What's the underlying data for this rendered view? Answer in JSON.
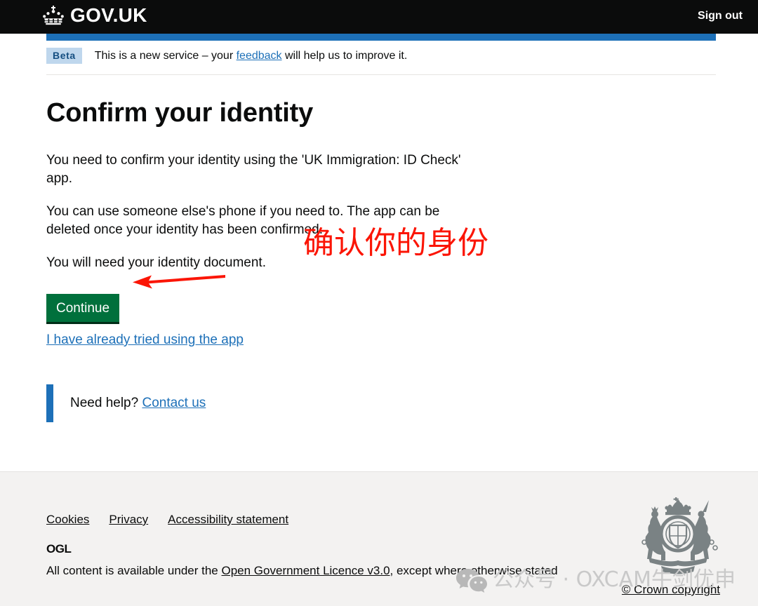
{
  "header": {
    "logo_text": "GOV.UK",
    "logo_icon": "crown-icon",
    "sign_out_label": "Sign out"
  },
  "phase_banner": {
    "tag": "Beta",
    "text_before": "This is a new service – your ",
    "link_label": "feedback",
    "text_after": " will help us to improve it."
  },
  "main": {
    "heading": "Confirm your identity",
    "paragraph_1": "You need to confirm your identity using the 'UK Immigration: ID Check' app.",
    "paragraph_2": "You can use someone else's phone if you need to. The app can be deleted once your identity has been confirmed.",
    "paragraph_3": "You will need your identity document.",
    "continue_button": "Continue",
    "already_tried_link": "I have already tried using the app",
    "inset": {
      "prefix": "Need help? ",
      "link_label": "Contact us"
    }
  },
  "annotations": {
    "chinese_note": "确认你的身份",
    "arrow_icon": "left-arrow-icon",
    "annotation_color": "#fb1505"
  },
  "footer": {
    "links": [
      {
        "label": "Cookies"
      },
      {
        "label": "Privacy"
      },
      {
        "label": "Accessibility statement"
      }
    ],
    "ogl_logo_text": "OGL",
    "licence_prefix": "All content is available under the ",
    "licence_link": "Open Government Licence v3.0",
    "licence_suffix": ", except where otherwise stated",
    "crown_copyright": "© Crown copyright",
    "royal_arms_icon": "royal-coat-of-arms-icon"
  },
  "watermark": {
    "icon": "wechat-icon",
    "text": "公众号 · OXCAM牛剑优申"
  },
  "colors": {
    "header_black": "#0b0c0c",
    "govuk_blue": "#1d70b8",
    "button_green": "#00703c",
    "button_green_shadow": "#002d18",
    "beta_tag_bg": "#bfd7ed",
    "footer_bg": "#f3f2f1",
    "annotation_red": "#fb1505",
    "watermark_gray": "#c9c9c9"
  }
}
